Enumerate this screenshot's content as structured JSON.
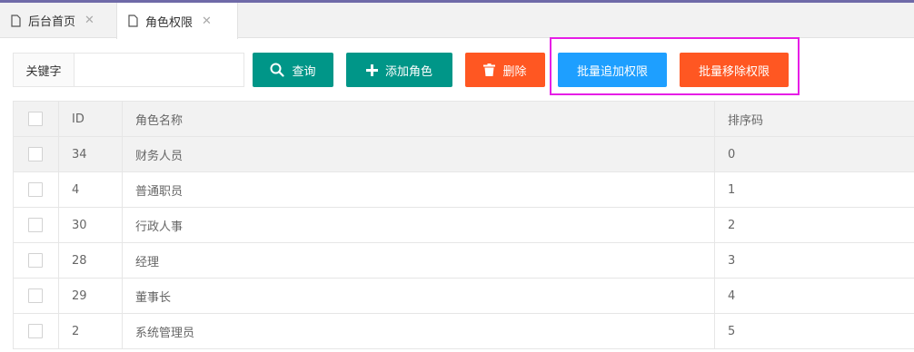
{
  "tabs": [
    {
      "label": "后台首页",
      "active": false
    },
    {
      "label": "角色权限",
      "active": true
    }
  ],
  "search": {
    "label": "关键字",
    "value": "",
    "placeholder": ""
  },
  "toolbar": {
    "query_label": "查询",
    "add_label": "添加角色",
    "delete_label": "删除",
    "batch_add_label": "批量追加权限",
    "batch_remove_label": "批量移除权限"
  },
  "table": {
    "headers": [
      "ID",
      "角色名称",
      "排序码"
    ],
    "rows": [
      {
        "id": "34",
        "name": "财务人员",
        "order": "0"
      },
      {
        "id": "4",
        "name": "普通职员",
        "order": "1"
      },
      {
        "id": "30",
        "name": "行政人事",
        "order": "2"
      },
      {
        "id": "28",
        "name": "经理",
        "order": "3"
      },
      {
        "id": "29",
        "name": "董事长",
        "order": "4"
      },
      {
        "id": "2",
        "name": "系统管理员",
        "order": "5"
      }
    ]
  },
  "colors": {
    "teal": "#009688",
    "orange": "#ff5722",
    "blue": "#1e9fff",
    "highlight": "#e61ee6"
  }
}
